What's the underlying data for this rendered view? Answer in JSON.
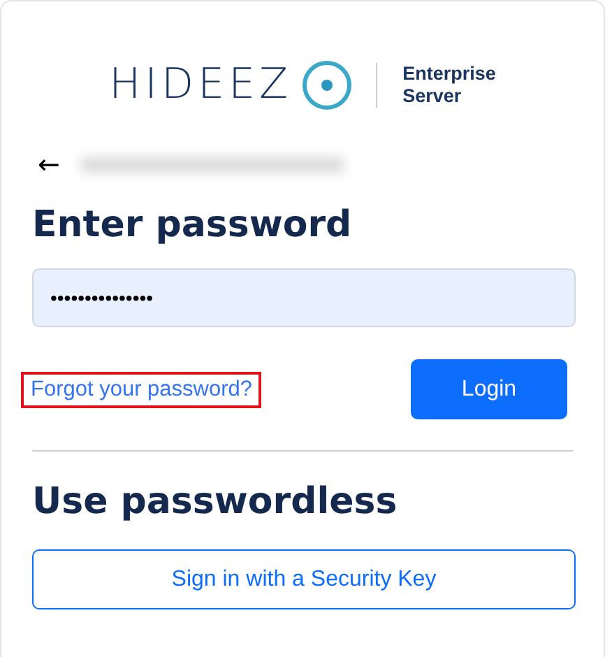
{
  "logo": {
    "wordmark": "HIDEEZ",
    "product": [
      "Enterprise",
      "Server"
    ]
  },
  "back": {
    "glyph": "←",
    "email_redacted": true
  },
  "password_section": {
    "heading": "Enter password",
    "password": {
      "value": "•••••••••••••••"
    },
    "forgot_link": {
      "label": "Forgot your password?",
      "highlighted": true
    },
    "login_button": "Login"
  },
  "passwordless_section": {
    "heading": "Use passwordless",
    "security_key_button": "Sign in with a Security Key"
  }
}
